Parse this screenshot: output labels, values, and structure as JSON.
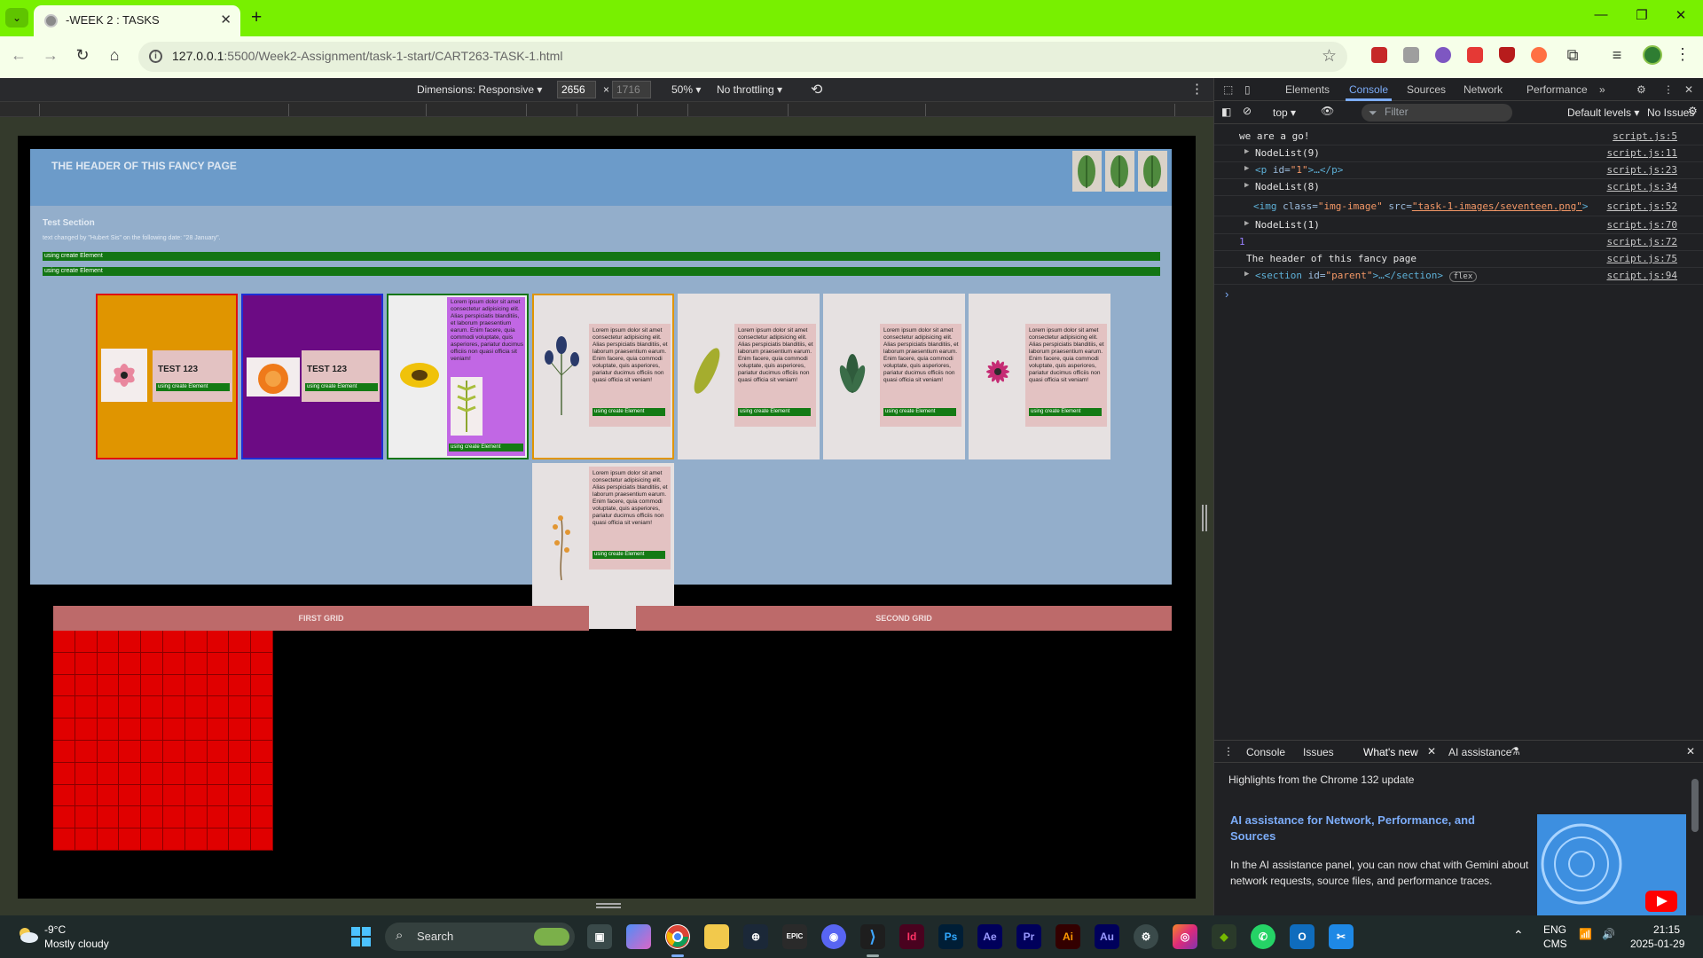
{
  "browser": {
    "tab_title": "-WEEK 2 : TASKS",
    "new_tab": "+",
    "url_host": "127.0.0.1",
    "url_rest": ":5500/Week2-Assignment/task-1-start/CART263-TASK-1.html"
  },
  "device_toolbar": {
    "dimensions_label": "Dimensions: Responsive",
    "width": "2656",
    "height": "1716",
    "times": "×",
    "zoom": "50%",
    "throttling": "No throttling"
  },
  "page": {
    "header_title": "The header of this fancy page",
    "section_title": "Test Section",
    "section_text": "text changed by \"Hubert Sis\" on the following date: \"28 January\".",
    "bar_label": "using create Element",
    "card_test_label": "TEST 123",
    "lorem": "Lorem ipsum dolor sit amet consectetur adipisicing elit. Alias perspiciatis blanditiis, et laborum praesentium earum. Enim facere, quia commodi voluptate, quis asperiores, pariatur ducimus officiis non quasi officia sit veniam!",
    "grid1_title": "FIRST GRID",
    "grid2_title": "SECOND GRID"
  },
  "devtools": {
    "tabs": [
      "Elements",
      "Console",
      "Sources",
      "Network",
      "Performance"
    ],
    "more": "»",
    "context": "top",
    "filter_placeholder": "Filter",
    "levels": "Default levels",
    "issues": "No Issues",
    "console_lines": [
      {
        "msg": "we are a go!",
        "src": "script.js:5"
      },
      {
        "msg": "NodeList(9)",
        "src": "script.js:11"
      },
      {
        "msg_tag": "<p",
        "msg_attr": " id=",
        "msg_val": "\"1\"",
        "msg_tail": ">…</p>",
        "src": "script.js:23"
      },
      {
        "msg": "NodeList(8)",
        "src": "script.js:34"
      },
      {
        "msg_tag": "<img",
        "msg_attr": " class=",
        "msg_val": "\"img-image\"",
        "msg_attr2": " src=",
        "msg_val2": "\"task-1-images/seventeen.png\"",
        "msg_tail": ">",
        "src": "script.js:52"
      },
      {
        "msg": "NodeList(1)",
        "src": "script.js:70"
      },
      {
        "msg": "1",
        "src": "script.js:72"
      },
      {
        "msg": "The header of this fancy page",
        "src": "script.js:75"
      },
      {
        "msg_tag": "<section",
        "msg_attr": " id=",
        "msg_val": "\"parent\"",
        "msg_tail": ">…</section>",
        "badge": "flex",
        "src": "script.js:94"
      }
    ],
    "prompt": "›",
    "drawer_tabs": [
      "Console",
      "Issues",
      "What's new",
      "AI assistance"
    ],
    "whats_new_highlight": "Highlights from the Chrome 132 update",
    "whats_new_heading": "AI assistance for Network, Performance, and Sources",
    "whats_new_body": "In the AI assistance panel, you can now chat with Gemini about network requests, source files, and performance traces."
  },
  "taskbar": {
    "temperature": "-9°C",
    "weather": "Mostly cloudy",
    "search_label": "Search",
    "lang": "ENG",
    "ime": "CMS",
    "time": "21:15",
    "date": "2025-01-29",
    "apps": [
      "Id",
      "Ps",
      "Ae",
      "Pr",
      "Ai",
      "Au"
    ]
  },
  "colors": {
    "tabstrip": "#78f000",
    "card_orange": "#e09500",
    "card_purple": "#6c0b84",
    "card_lilac": "#c167e4",
    "grid_red": "#e00000"
  }
}
